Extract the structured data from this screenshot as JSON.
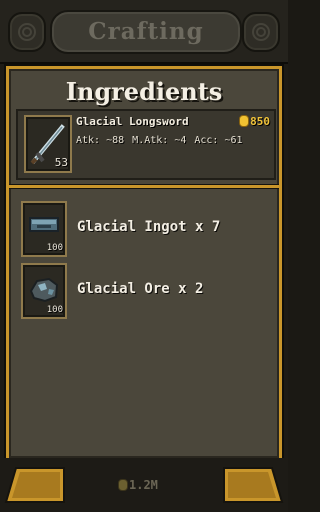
{
  "header": {
    "title": "Crafting"
  },
  "panel": {
    "heading": "Ingredients",
    "result": {
      "name": "Glacial Longsword",
      "price": "850",
      "count": "53",
      "stats": {
        "atk": "Atk: ~88",
        "matk": "M.Atk: ~4",
        "acc": "Acc: ~61"
      }
    },
    "ingredients": [
      {
        "label": "Glacial Ingot x 7",
        "count": "100",
        "icon": "ingot-icon"
      },
      {
        "label": "Glacial Ore x 2",
        "count": "100",
        "icon": "ore-icon"
      }
    ]
  },
  "footer": {
    "cost": "1.2M"
  },
  "colors": {
    "gold_border": "#c9962b",
    "panel_bg": "#4b473b",
    "coin": "#f1c232"
  }
}
